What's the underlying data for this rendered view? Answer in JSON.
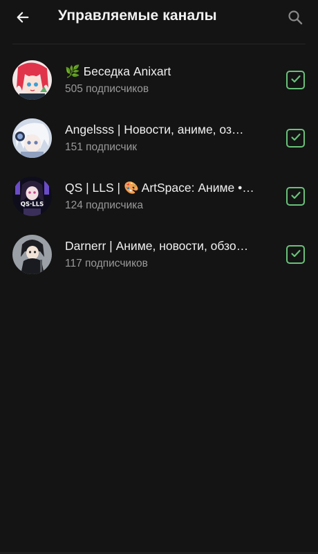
{
  "header": {
    "title": "Управляемые каналы",
    "back_icon": "arrow-left-icon",
    "search_icon": "search-icon"
  },
  "colors": {
    "background": "#141414",
    "accent_check": "#69c27a",
    "secondary_text": "#9a9a9a"
  },
  "channels": [
    {
      "name": "🌿 Беседка Anixart",
      "subscribers": "505 подписчиков",
      "checked": true
    },
    {
      "name": "Angelsss | Новости, аниме, оз…",
      "subscribers": "151 подписчик",
      "checked": true
    },
    {
      "name": "QS | LLS | 🎨 ArtSpace: Аниме •…",
      "subscribers": "124 подписчика",
      "checked": true
    },
    {
      "name": "Darnerr | Аниме, новости, обзо…",
      "subscribers": "117 подписчиков",
      "checked": true
    }
  ]
}
